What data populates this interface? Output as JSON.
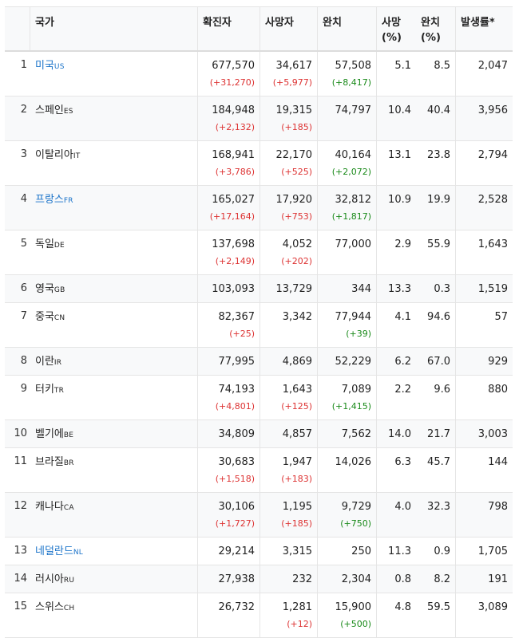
{
  "headers": {
    "country": "국가",
    "confirmed": "확진자",
    "deaths": "사망자",
    "recovered": "완치",
    "death_rate": [
      "사망",
      "(%)"
    ],
    "recovery_rate": [
      "완치",
      "(%)"
    ],
    "incidence": "발생률*"
  },
  "rows": [
    {
      "rank": "1",
      "name": "미국",
      "code": "US",
      "link": true,
      "confirmed": "677,570",
      "confirmed_delta": "(+31,270)",
      "deaths": "34,617",
      "deaths_delta": "(+5,977)",
      "recovered": "57,508",
      "recovered_delta": "(+8,417)",
      "death_rate": "5.1",
      "recovery_rate": "8.5",
      "incidence": "2,047"
    },
    {
      "rank": "2",
      "name": "스페인",
      "code": "ES",
      "link": false,
      "confirmed": "184,948",
      "confirmed_delta": "(+2,132)",
      "deaths": "19,315",
      "deaths_delta": "(+185)",
      "recovered": "74,797",
      "recovered_delta": "",
      "death_rate": "10.4",
      "recovery_rate": "40.4",
      "incidence": "3,956"
    },
    {
      "rank": "3",
      "name": "이탈리아",
      "code": "IT",
      "link": false,
      "confirmed": "168,941",
      "confirmed_delta": "(+3,786)",
      "deaths": "22,170",
      "deaths_delta": "(+525)",
      "recovered": "40,164",
      "recovered_delta": "(+2,072)",
      "death_rate": "13.1",
      "recovery_rate": "23.8",
      "incidence": "2,794"
    },
    {
      "rank": "4",
      "name": "프랑스",
      "code": "FR",
      "link": true,
      "confirmed": "165,027",
      "confirmed_delta": "(+17,164)",
      "deaths": "17,920",
      "deaths_delta": "(+753)",
      "recovered": "32,812",
      "recovered_delta": "(+1,817)",
      "death_rate": "10.9",
      "recovery_rate": "19.9",
      "incidence": "2,528"
    },
    {
      "rank": "5",
      "name": "독일",
      "code": "DE",
      "link": false,
      "confirmed": "137,698",
      "confirmed_delta": "(+2,149)",
      "deaths": "4,052",
      "deaths_delta": "(+202)",
      "recovered": "77,000",
      "recovered_delta": "",
      "death_rate": "2.9",
      "recovery_rate": "55.9",
      "incidence": "1,643"
    },
    {
      "rank": "6",
      "name": "영국",
      "code": "GB",
      "link": false,
      "confirmed": "103,093",
      "confirmed_delta": "",
      "deaths": "13,729",
      "deaths_delta": "",
      "recovered": "344",
      "recovered_delta": "",
      "death_rate": "13.3",
      "recovery_rate": "0.3",
      "incidence": "1,519"
    },
    {
      "rank": "7",
      "name": "중국",
      "code": "CN",
      "link": false,
      "confirmed": "82,367",
      "confirmed_delta": "(+25)",
      "deaths": "3,342",
      "deaths_delta": "",
      "recovered": "77,944",
      "recovered_delta": "(+39)",
      "death_rate": "4.1",
      "recovery_rate": "94.6",
      "incidence": "57"
    },
    {
      "rank": "8",
      "name": "이란",
      "code": "IR",
      "link": false,
      "confirmed": "77,995",
      "confirmed_delta": "",
      "deaths": "4,869",
      "deaths_delta": "",
      "recovered": "52,229",
      "recovered_delta": "",
      "death_rate": "6.2",
      "recovery_rate": "67.0",
      "incidence": "929"
    },
    {
      "rank": "9",
      "name": "터키",
      "code": "TR",
      "link": false,
      "confirmed": "74,193",
      "confirmed_delta": "(+4,801)",
      "deaths": "1,643",
      "deaths_delta": "(+125)",
      "recovered": "7,089",
      "recovered_delta": "(+1,415)",
      "death_rate": "2.2",
      "recovery_rate": "9.6",
      "incidence": "880"
    },
    {
      "rank": "10",
      "name": "벨기에",
      "code": "BE",
      "link": false,
      "confirmed": "34,809",
      "confirmed_delta": "",
      "deaths": "4,857",
      "deaths_delta": "",
      "recovered": "7,562",
      "recovered_delta": "",
      "death_rate": "14.0",
      "recovery_rate": "21.7",
      "incidence": "3,003"
    },
    {
      "rank": "11",
      "name": "브라질",
      "code": "BR",
      "link": false,
      "confirmed": "30,683",
      "confirmed_delta": "(+1,518)",
      "deaths": "1,947",
      "deaths_delta": "(+183)",
      "recovered": "14,026",
      "recovered_delta": "",
      "death_rate": "6.3",
      "recovery_rate": "45.7",
      "incidence": "144"
    },
    {
      "rank": "12",
      "name": "캐나다",
      "code": "CA",
      "link": false,
      "confirmed": "30,106",
      "confirmed_delta": "(+1,727)",
      "deaths": "1,195",
      "deaths_delta": "(+185)",
      "recovered": "9,729",
      "recovered_delta": "(+750)",
      "death_rate": "4.0",
      "recovery_rate": "32.3",
      "incidence": "798"
    },
    {
      "rank": "13",
      "name": "네덜란드",
      "code": "NL",
      "link": true,
      "confirmed": "29,214",
      "confirmed_delta": "",
      "deaths": "3,315",
      "deaths_delta": "",
      "recovered": "250",
      "recovered_delta": "",
      "death_rate": "11.3",
      "recovery_rate": "0.9",
      "incidence": "1,705"
    },
    {
      "rank": "14",
      "name": "러시아",
      "code": "RU",
      "link": false,
      "confirmed": "27,938",
      "confirmed_delta": "",
      "deaths": "232",
      "deaths_delta": "",
      "recovered": "2,304",
      "recovered_delta": "",
      "death_rate": "0.8",
      "recovery_rate": "8.2",
      "incidence": "191"
    },
    {
      "rank": "15",
      "name": "스위스",
      "code": "CH",
      "link": false,
      "confirmed": "26,732",
      "confirmed_delta": "",
      "deaths": "1,281",
      "deaths_delta": "(+12)",
      "recovered": "15,900",
      "recovered_delta": "(+500)",
      "death_rate": "4.8",
      "recovery_rate": "59.5",
      "incidence": "3,089"
    }
  ]
}
